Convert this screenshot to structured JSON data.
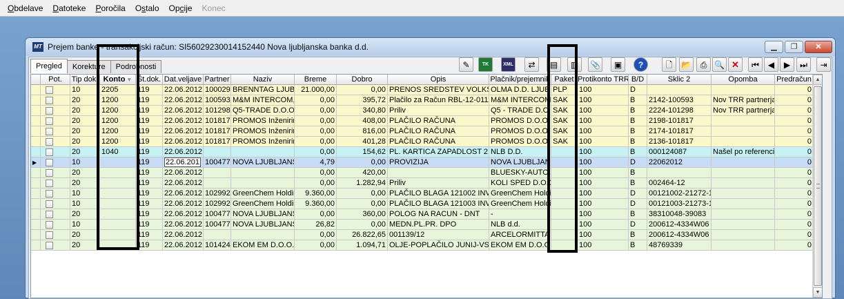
{
  "menu": [
    {
      "pre": "",
      "ul": "O",
      "post": "bdelave",
      "disabled": false
    },
    {
      "pre": "",
      "ul": "D",
      "post": "atoteke",
      "disabled": false
    },
    {
      "pre": "",
      "ul": "P",
      "post": "oročila",
      "disabled": false
    },
    {
      "pre": "O",
      "ul": "s",
      "post": "talo",
      "disabled": false
    },
    {
      "pre": "Op",
      "ul": "c",
      "post": "ije",
      "disabled": false
    },
    {
      "pre": "Konec",
      "ul": "",
      "post": "",
      "disabled": true
    }
  ],
  "window": {
    "icon": "MT",
    "title": "Prejem banke - transakcijski račun: SI56029230014152440  Nova ljubljanska banka d.d.",
    "min": "▁",
    "max": "❐",
    "close": "✕"
  },
  "tabs": [
    "Pregled",
    "Korekture",
    "Podrobnosti"
  ],
  "toolbar_icons": [
    {
      "name": "edit-pencil-icon",
      "glyph": "✎",
      "style": ""
    },
    {
      "name": "tk-green-icon",
      "glyph": "TK",
      "style": "green"
    },
    {
      "name": "xml-icon",
      "glyph": "XML",
      "style": "dark"
    },
    {
      "name": "transfer-icon",
      "glyph": "⇄",
      "style": ""
    },
    {
      "name": "document-send-icon",
      "glyph": "▤",
      "style": ""
    },
    {
      "name": "document-receive-icon",
      "glyph": "▥",
      "style": ""
    },
    {
      "name": "paperclip-icon",
      "glyph": "📎",
      "style": ""
    },
    {
      "name": "monitor-icon",
      "glyph": "▣",
      "style": ""
    },
    {
      "name": "help-icon",
      "glyph": "?",
      "style": "blue"
    },
    {
      "name": "new-document-icon",
      "glyph": "🗋",
      "style": ""
    },
    {
      "name": "open-folder-icon",
      "glyph": "📂",
      "style": ""
    },
    {
      "name": "print-icon",
      "glyph": "⎙",
      "style": ""
    },
    {
      "name": "search-icon",
      "glyph": "🔍",
      "style": ""
    },
    {
      "name": "delete-icon",
      "glyph": "✕",
      "style": "red"
    },
    {
      "name": "first-record-icon",
      "glyph": "⏮",
      "style": ""
    },
    {
      "name": "previous-record-icon",
      "glyph": "◀",
      "style": ""
    },
    {
      "name": "next-record-icon",
      "glyph": "▶",
      "style": ""
    },
    {
      "name": "last-record-icon",
      "glyph": "⏭",
      "style": ""
    },
    {
      "name": "exit-door-icon",
      "glyph": "⇥",
      "style": ""
    }
  ],
  "columns": [
    {
      "key": "ind",
      "label": ""
    },
    {
      "key": "pot",
      "label": "Pot."
    },
    {
      "key": "tip",
      "label": "Tip dok."
    },
    {
      "key": "konto",
      "label": "Konto"
    },
    {
      "key": "stdok",
      "label": "Št.dok."
    },
    {
      "key": "datv",
      "label": "Dat.veljave"
    },
    {
      "key": "partner",
      "label": "Partner"
    },
    {
      "key": "naziv",
      "label": "Naziv"
    },
    {
      "key": "breme",
      "label": "Breme"
    },
    {
      "key": "dobro",
      "label": "Dobro"
    },
    {
      "key": "opis",
      "label": "Opis"
    },
    {
      "key": "placnik",
      "label": "Plačnik/prejemnik"
    },
    {
      "key": "paket",
      "label": "Paket"
    },
    {
      "key": "protikonto",
      "label": "Protikonto TRR"
    },
    {
      "key": "bd",
      "label": "B/D"
    },
    {
      "key": "sklic",
      "label": "Sklic 2"
    },
    {
      "key": "opomba",
      "label": "Opomba"
    },
    {
      "key": "predracun",
      "label": "Predračun"
    }
  ],
  "sorted_column": "konto",
  "rows": [
    {
      "color": "yellow",
      "current": false,
      "tip": "10",
      "konto": "2205",
      "stdok": "119",
      "datv": "22.06.2012",
      "partner": "100029",
      "naziv": "BRENNTAG LJUB",
      "breme": "21.000,00",
      "dobro": "0,00",
      "opis": "PRENOS SREDSTEV VOLKSI",
      "placnik": "OLMA  D.D. LJUE",
      "paket": "PLP",
      "protikonto": "100",
      "bd": "D",
      "sklic": "",
      "opomba": "",
      "predracun": "0"
    },
    {
      "color": "yellow",
      "current": false,
      "tip": "20",
      "konto": "1200",
      "stdok": "119",
      "datv": "22.06.2012",
      "partner": "100593",
      "naziv": "M&M INTERCOM,",
      "breme": "0,00",
      "dobro": "395,72",
      "opis": "Plačilo za Račun RBL-12-0111",
      "placnik": "M&M INTERCOM",
      "paket": "SAK",
      "protikonto": "100",
      "bd": "B",
      "sklic": "2142-100593",
      "opomba": "Nov TRR partnerja",
      "predracun": "0"
    },
    {
      "color": "yellow",
      "current": false,
      "tip": "20",
      "konto": "1200",
      "stdok": "119",
      "datv": "22.06.2012",
      "partner": "101298",
      "naziv": "Q5-TRADE D.O.O",
      "breme": "0,00",
      "dobro": "340,80",
      "opis": "Priliv",
      "placnik": "Q5 - TRADE D.O",
      "paket": "SAK",
      "protikonto": "100",
      "bd": "B",
      "sklic": "2224-101298",
      "opomba": "Nov TRR partnerja",
      "predracun": "0"
    },
    {
      "color": "yellow",
      "current": false,
      "tip": "20",
      "konto": "1200",
      "stdok": "119",
      "datv": "22.06.2012",
      "partner": "101817",
      "naziv": "PROMOS Inženirin",
      "breme": "0,00",
      "dobro": "408,00",
      "opis": "PLAČILO RAČUNA",
      "placnik": "PROMOS D.O.O.",
      "paket": "SAK",
      "protikonto": "100",
      "bd": "B",
      "sklic": "2198-101817",
      "opomba": "",
      "predracun": "0"
    },
    {
      "color": "yellow",
      "current": false,
      "tip": "20",
      "konto": "1200",
      "stdok": "119",
      "datv": "22.06.2012",
      "partner": "101817",
      "naziv": "PROMOS Inženirin",
      "breme": "0,00",
      "dobro": "816,00",
      "opis": "PLAČILO RAČUNA",
      "placnik": "PROMOS D.O.O.",
      "paket": "SAK",
      "protikonto": "100",
      "bd": "B",
      "sklic": "2174-101817",
      "opomba": "",
      "predracun": "0"
    },
    {
      "color": "yellow",
      "current": false,
      "tip": "20",
      "konto": "1200",
      "stdok": "119",
      "datv": "22.06.2012",
      "partner": "101817",
      "naziv": "PROMOS Inženirin",
      "breme": "0,00",
      "dobro": "401,28",
      "opis": "PLAČILO RAČUNA",
      "placnik": "PROMOS D.O.O.",
      "paket": "SAK",
      "protikonto": "100",
      "bd": "B",
      "sklic": "2136-101817",
      "opomba": "",
      "predracun": "0"
    },
    {
      "color": "cyan",
      "current": false,
      "tip": "20",
      "konto": "1040",
      "stdok": "119",
      "datv": "22.06.2012",
      "partner": "",
      "naziv": "",
      "breme": "0,00",
      "dobro": "154,62",
      "opis": "PL. KARTICA ZAPADLOST 21",
      "placnik": "NLB D.D.",
      "paket": "",
      "protikonto": "100",
      "bd": "B",
      "sklic": "000124087",
      "opomba": "Našel po referenci p",
      "predracun": "0"
    },
    {
      "color": "selected",
      "current": true,
      "tip": "10",
      "konto": "",
      "stdok": "119",
      "datv": "22.06.201",
      "partner": "100477",
      "naziv": "NOVA LJUBLJANS",
      "breme": "4,79",
      "dobro": "0,00",
      "opis": "PROVIZIJA",
      "placnik": "NOVA LJUBLJAN",
      "paket": "",
      "protikonto": "100",
      "bd": "D",
      "sklic": "22062012",
      "opomba": "",
      "predracun": "0"
    },
    {
      "color": "green",
      "current": false,
      "tip": "20",
      "konto": "",
      "stdok": "119",
      "datv": "22.06.2012",
      "partner": "",
      "naziv": "",
      "breme": "0,00",
      "dobro": "420,00",
      "opis": "",
      "placnik": "BLUESKY-AUTO",
      "paket": "",
      "protikonto": "100",
      "bd": "B",
      "sklic": "",
      "opomba": "",
      "predracun": "0"
    },
    {
      "color": "green",
      "current": false,
      "tip": "20",
      "konto": "",
      "stdok": "119",
      "datv": "22.06.2012",
      "partner": "",
      "naziv": "",
      "breme": "0,00",
      "dobro": "1.282,94",
      "opis": "Priliv",
      "placnik": "KOLI SPED D.O.O",
      "paket": "",
      "protikonto": "100",
      "bd": "B",
      "sklic": "002464-12",
      "opomba": "",
      "predracun": "0"
    },
    {
      "color": "green",
      "current": false,
      "tip": "10",
      "konto": "",
      "stdok": "119",
      "datv": "22.06.2012",
      "partner": "102992",
      "naziv": "GreenChem Holdir",
      "breme": "9.360,00",
      "dobro": "0,00",
      "opis": "PLAČILO BLAGA 121002 INVO",
      "placnik": "GreenChem Holdi",
      "paket": "",
      "protikonto": "100",
      "bd": "D",
      "sklic": "00121002-21272-1",
      "opomba": "",
      "predracun": "0"
    },
    {
      "color": "green",
      "current": false,
      "tip": "10",
      "konto": "",
      "stdok": "119",
      "datv": "22.06.2012",
      "partner": "102992",
      "naziv": "GreenChem Holdir",
      "breme": "9.360,00",
      "dobro": "0,00",
      "opis": "PLAČILO BLAGA 121003 INVO",
      "placnik": "GreenChem Holdi",
      "paket": "",
      "protikonto": "100",
      "bd": "D",
      "sklic": "00121003-21273-1",
      "opomba": "",
      "predracun": "0"
    },
    {
      "color": "green",
      "current": false,
      "tip": "20",
      "konto": "",
      "stdok": "119",
      "datv": "22.06.2012",
      "partner": "100477",
      "naziv": "NOVA LJUBLJANS",
      "breme": "0,00",
      "dobro": "360,00",
      "opis": "POLOG NA RACUN - DNT",
      "placnik": "-",
      "paket": "",
      "protikonto": "100",
      "bd": "B",
      "sklic": "38310048-39083",
      "opomba": "",
      "predracun": "0"
    },
    {
      "color": "green",
      "current": false,
      "tip": "10",
      "konto": "",
      "stdok": "119",
      "datv": "22.06.2012",
      "partner": "100477",
      "naziv": "NOVA LJUBLJANS",
      "breme": "26,82",
      "dobro": "0,00",
      "opis": "MEDN.PL.PR. DPO",
      "placnik": "NLB d.d.",
      "paket": "",
      "protikonto": "100",
      "bd": "D",
      "sklic": "200612-4334W06",
      "opomba": "",
      "predracun": "0"
    },
    {
      "color": "green",
      "current": false,
      "tip": "20",
      "konto": "",
      "stdok": "119",
      "datv": "22.06.2012",
      "partner": "",
      "naziv": "",
      "breme": "0,00",
      "dobro": "26.822,65",
      "opis": "001139/12",
      "placnik": "ARCELORMITTA",
      "paket": "",
      "protikonto": "100",
      "bd": "B",
      "sklic": "200612-4334W06",
      "opomba": "",
      "predracun": "0"
    },
    {
      "color": "green",
      "current": false,
      "tip": "20",
      "konto": "",
      "stdok": "119",
      "datv": "22.06.2012",
      "partner": "101424",
      "naziv": "EKOM EM D.O.O.",
      "breme": "0,00",
      "dobro": "1.094,71",
      "opis": "OLJE-POPLAČILO JUNIJ-VSE",
      "placnik": "EKOM EM D.O.O",
      "paket": "",
      "protikonto": "100",
      "bd": "B",
      "sklic": "48769339",
      "opomba": "",
      "predracun": "0"
    }
  ],
  "current_row_marker": "▶",
  "sort_glyph": "▼",
  "scrollbar": {
    "up": "▲",
    "down": "▼"
  },
  "colors": {
    "yellow_row": "#fbf8cc",
    "green_row": "#e7f6da",
    "cyan_row": "#c6f2f4",
    "selected_row": "#c7ddf5",
    "highlight_box": "#000000"
  }
}
